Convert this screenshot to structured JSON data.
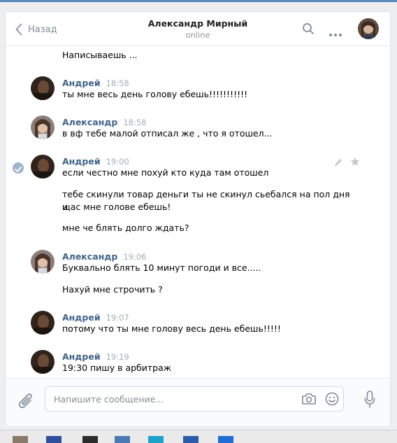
{
  "header": {
    "back_label": "Назад",
    "contact_name": "Александр Мирный",
    "contact_status": "online"
  },
  "messages": [
    {
      "text": "Написываешь ..."
    },
    {
      "author": "Андрей",
      "time": "18:58",
      "texts": [
        "ты мне весь день голову ебешь!!!!!!!!!!!"
      ]
    },
    {
      "author": "Александр",
      "time": "18:58",
      "texts": [
        "в вф тебе малой отписал же , что я отошел..."
      ]
    },
    {
      "author": "Андрей",
      "time": "19:00",
      "selected": true,
      "texts": [
        "если честно мне похуй кто куда там отошел",
        "тебе скинули товар деньги ты не скинул сьебался на пол дня и",
        "щас мне голове ебешь!",
        "мне че блять долго ждать?"
      ]
    },
    {
      "author": "Александр",
      "time": "19:06",
      "texts": [
        "Буквально блять 10 минут погоди и все.....",
        "Нахуй мне строчить ?"
      ]
    },
    {
      "author": "Андрей",
      "time": "19:07",
      "texts": [
        "потому что ты мне голову весь день ебешь!!!!!"
      ]
    },
    {
      "author": "Андрей",
      "time": "19:19",
      "texts": [
        "19:30 пишу в арбитраж"
      ]
    }
  ],
  "composer": {
    "placeholder": "Напишите сообщение..."
  },
  "icons": {
    "back": "chevron-left-icon",
    "search": "search-icon",
    "more": "more-dots-icon",
    "attach": "paperclip-icon",
    "camera": "camera-icon",
    "emoji": "smile-icon",
    "mic": "microphone-icon",
    "edit": "pencil-icon",
    "favorite": "star-icon",
    "selected": "check-circle-icon"
  },
  "colors": {
    "accent": "#5b88bd",
    "author_name": "#42648b",
    "muted": "#828a99",
    "selected_check": "#9db3ce"
  }
}
